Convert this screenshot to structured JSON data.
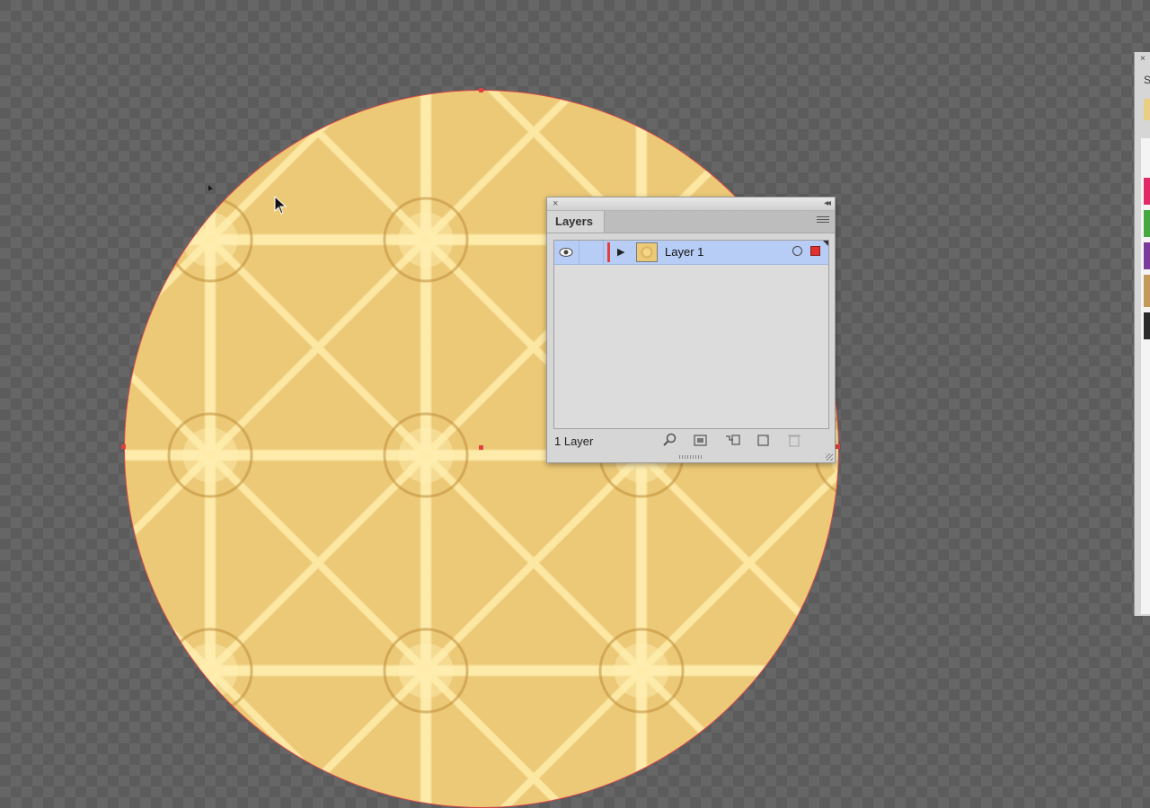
{
  "layers_panel": {
    "tab_label": "Layers",
    "layer_row": {
      "name": "Layer 1"
    },
    "footer": {
      "layer_count": "1 Layer"
    }
  },
  "swatches_panel": {
    "tab_label_partial": "S"
  },
  "colors": {
    "artwork_fill": "#ecc977",
    "layer_color": "#e04040",
    "selection_highlight": "#b7cdf6",
    "panel_bg": "#d6d6d6"
  },
  "icons": {
    "visibility": "eye-icon",
    "expand": "triangle-right-icon",
    "target": "target-circle-icon",
    "selected_art": "selection-square-icon",
    "search": "locate-object-icon",
    "clipping_mask": "clipping-mask-icon",
    "new_sublayer": "new-sublayer-icon",
    "new_layer": "new-layer-icon",
    "delete": "trash-icon",
    "panel_menu": "panel-menu-icon",
    "cursor": "arrow-cursor-icon"
  }
}
